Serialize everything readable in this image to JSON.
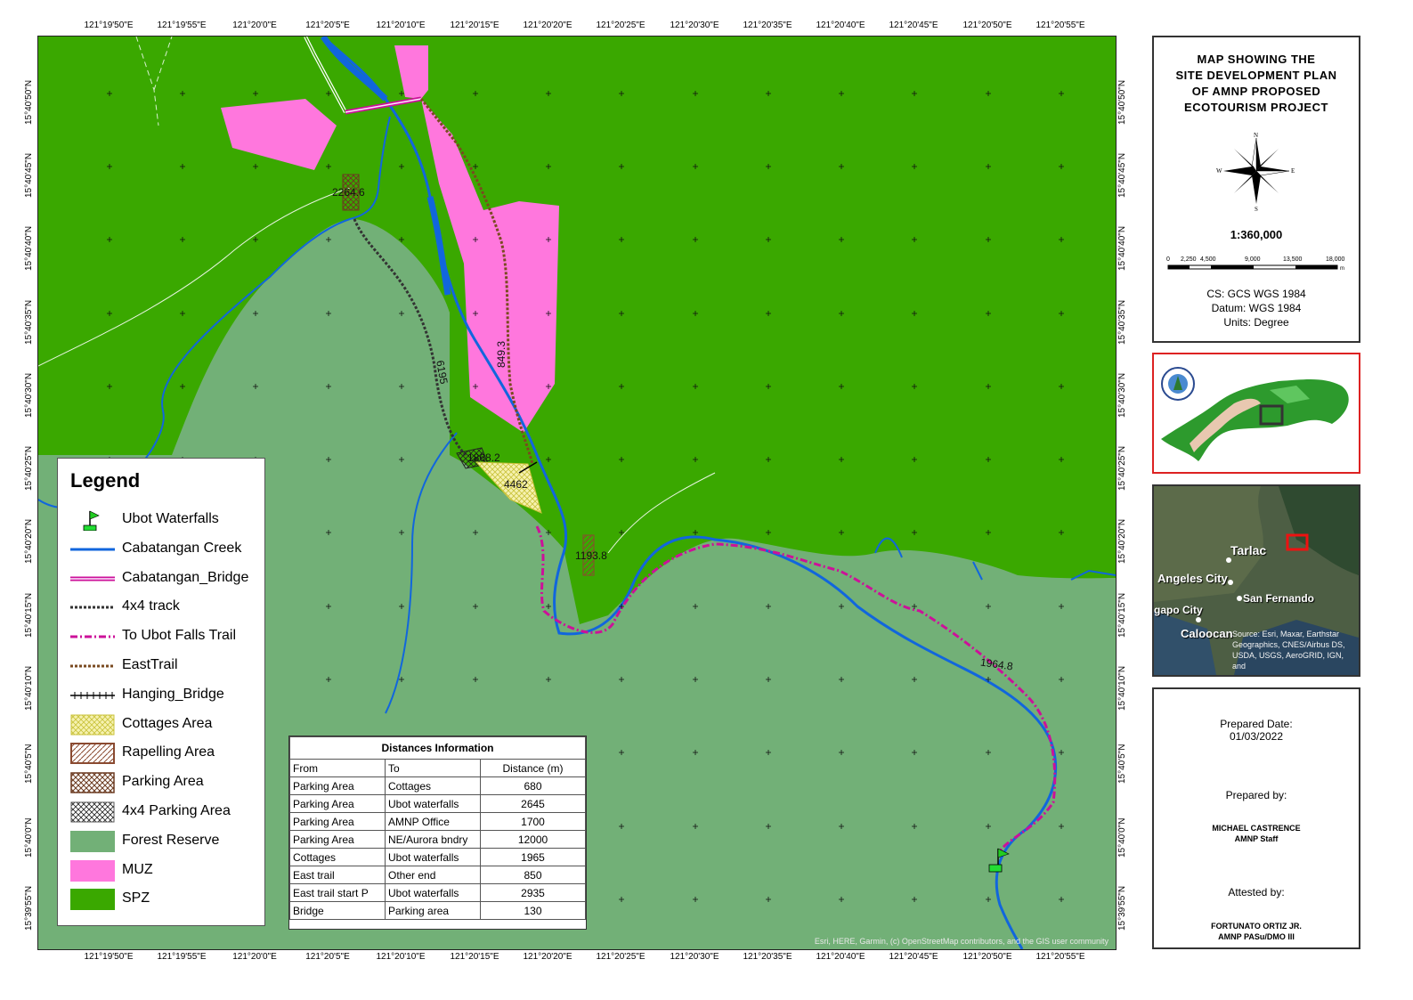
{
  "map": {
    "coords_top": [
      "121°19'50\"E",
      "121°19'55\"E",
      "121°20'0\"E",
      "121°20'5\"E",
      "121°20'10\"E",
      "121°20'15\"E",
      "121°20'20\"E",
      "121°20'25\"E",
      "121°20'30\"E",
      "121°20'35\"E",
      "121°20'40\"E",
      "121°20'45\"E",
      "121°20'50\"E",
      "121°20'55\"E"
    ],
    "coords_side": [
      "15°40'50\"N",
      "15°40'45\"N",
      "15°40'40\"N",
      "15°40'35\"N",
      "15°40'30\"N",
      "15°40'25\"N",
      "15°40'20\"N",
      "15°40'15\"N",
      "15°40'10\"N",
      "15°40'5\"N",
      "15°40'0\"N",
      "15°39'55\"N"
    ],
    "labels": {
      "l1": "2264.6",
      "l2": "849.3",
      "l3": "6195",
      "l4": "1868.2",
      "l5": "4462",
      "l6": "1193.8",
      "l7": "1964.8"
    },
    "attribution": "Esri, HERE, Garmin, (c) OpenStreetMap contributors, and the GIS user community"
  },
  "legend": {
    "title": "Legend",
    "items": [
      {
        "label": "Ubot Waterfalls",
        "icon": "flag-icon"
      },
      {
        "label": "Cabatangan Creek"
      },
      {
        "label": "Cabatangan_Bridge"
      },
      {
        "label": "4x4 track"
      },
      {
        "label": "To Ubot Falls Trail"
      },
      {
        "label": "EastTrail"
      },
      {
        "label": "Hanging_Bridge"
      },
      {
        "label": "Cottages Area"
      },
      {
        "label": "Rapelling Area"
      },
      {
        "label": "Parking Area"
      },
      {
        "label": "4x4 Parking Area"
      },
      {
        "label": "Forest Reserve"
      },
      {
        "label": "MUZ"
      },
      {
        "label": "SPZ"
      }
    ],
    "colors": {
      "forest_reserve": "#72b077",
      "muz": "#ff77dd",
      "spz": "#3aa800",
      "creek": "#1166dd",
      "trail": "#cc1199"
    }
  },
  "distances": {
    "caption": "Distances Information",
    "headers": [
      "From",
      "To",
      "Distance (m)"
    ],
    "rows": [
      [
        "Parking Area",
        "Cottages",
        "680"
      ],
      [
        "Parking Area",
        "Ubot waterfalls",
        "2645"
      ],
      [
        "Parking Area",
        "AMNP Office",
        "1700"
      ],
      [
        "Parking Area",
        "NE/Aurora bndry",
        "12000"
      ],
      [
        "Cottages",
        "Ubot waterfalls",
        "1965"
      ],
      [
        "East trail",
        "Other end",
        "850"
      ],
      [
        "East trail start P",
        "Ubot waterfalls",
        "2935"
      ],
      [
        "Bridge",
        "Parking area",
        "130"
      ]
    ]
  },
  "title_panel": {
    "title_lines": [
      "MAP SHOWING THE",
      "SITE DEVELOPMENT PLAN",
      "OF AMNP PROPOSED",
      "ECOTOURISM PROJECT"
    ],
    "compass": {
      "n": "N",
      "s": "S",
      "e": "E",
      "w": "W"
    },
    "scale": "1:360,000",
    "scalebar_ticks": [
      "0",
      "2,250",
      "4,500",
      "9,000",
      "13,500",
      "18,000"
    ],
    "scalebar_unit": "m",
    "cs": "CS: GCS WGS 1984",
    "datum": "Datum: WGS 1984",
    "units": "Units: Degree"
  },
  "satellite": {
    "labels": [
      "Tarlac",
      "Angeles City",
      "San Fernando",
      "gapo City",
      "Caloocan"
    ],
    "credit": "Source: Esri, Maxar, Earthstar Geographics, CNES/Airbus DS, USDA, USGS, AeroGRID, IGN, and"
  },
  "info_panel": {
    "prepared_date_label": "Prepared Date:",
    "prepared_date": "01/03/2022",
    "prepared_by_label": "Prepared by:",
    "preparer_name": "MICHAEL CASTRENCE",
    "preparer_role": "AMNP Staff",
    "attested_by_label": "Attested by:",
    "attester_name": "FORTUNATO ORTIZ JR.",
    "attester_role": "AMNP PASu/DMO III"
  }
}
